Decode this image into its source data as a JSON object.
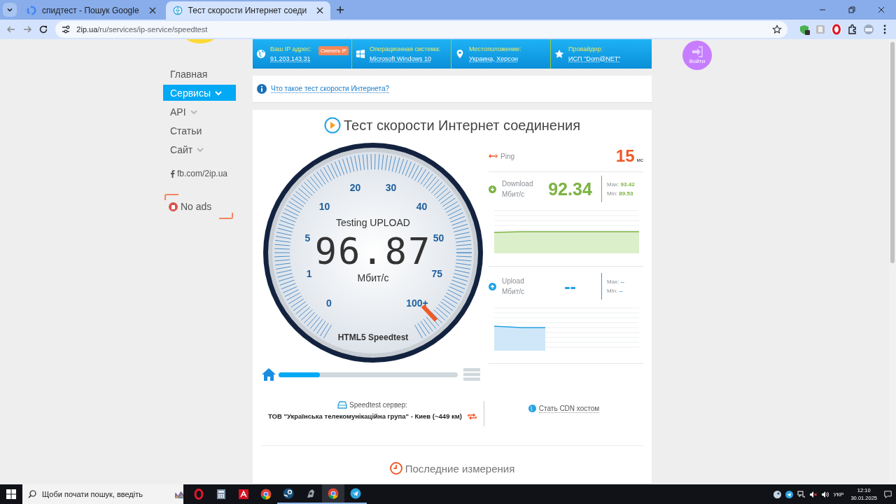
{
  "browser": {
    "tabs": [
      {
        "title": "спидтест - Пошук Google",
        "selected": false
      },
      {
        "title": "Тест скорости Интернет соеди",
        "selected": true
      }
    ],
    "url_host": "2ip.ua",
    "url_path": "/ru/services/ip-service/speedtest"
  },
  "info_bar": [
    {
      "kind": "ip",
      "label": "Ваш IP адрес:",
      "value": "91.203.143.31",
      "button": "Сменить IP"
    },
    {
      "kind": "os",
      "label": "Операционная система:",
      "value": "Microsoft Windows 10"
    },
    {
      "kind": "location",
      "label": "Местоположение:",
      "value": "Украина, Херсон"
    },
    {
      "kind": "provider",
      "label": "Провайдер:",
      "value": "ИСП \"Dom@NET\""
    }
  ],
  "nav": [
    {
      "label": "Главная",
      "selected": false,
      "submenu": false
    },
    {
      "label": "Сервисы",
      "selected": true,
      "submenu": true
    },
    {
      "label": "API",
      "selected": false,
      "submenu": true
    },
    {
      "label": "Статьи",
      "selected": false,
      "submenu": false
    },
    {
      "label": "Сайт",
      "selected": false,
      "submenu": true
    }
  ],
  "social_link": "fb.com/2ip.ua",
  "ads_label": "No ads",
  "login_label": "Войти",
  "info_link": "Что такое тест скорости Интернета?",
  "speedtest": {
    "title": "Тест скорости Интернет соединения",
    "gauge": {
      "status": "Testing UPLOAD",
      "reading": "96.87",
      "unit": "Мбит/с",
      "engine": "HTML5 Speedtest",
      "dial_labels": [
        "0",
        "1",
        "5",
        "10",
        "20",
        "30",
        "40",
        "50",
        "75",
        "100+"
      ]
    },
    "progress": {
      "level": 0.23
    },
    "ping": {
      "label": "Ping",
      "value": "15",
      "unit": "мс"
    },
    "download": {
      "label": "Download",
      "unit": "Мбит/с",
      "value": "92.34",
      "max_label": "Max:",
      "max": "93.42",
      "min_label": "Min:",
      "min": "89.53"
    },
    "upload": {
      "label": "Upload",
      "unit": "Мбит/с",
      "value": "--",
      "max_label": "Max:",
      "max": "--",
      "min_label": "Min:",
      "min": "--"
    },
    "server": {
      "label": "Speedtest сервер:",
      "name": "ТОВ \"Українська телекомунікаційна група\" - Киев (~449 км)"
    },
    "cdn_link": "Стать CDN хостом",
    "recent_title": "Последние измерения"
  },
  "taskbar": {
    "search_placeholder": "Щоби почати пошук, введіть",
    "language": "УКР",
    "time": "12:10",
    "date": "30.01.2025"
  }
}
